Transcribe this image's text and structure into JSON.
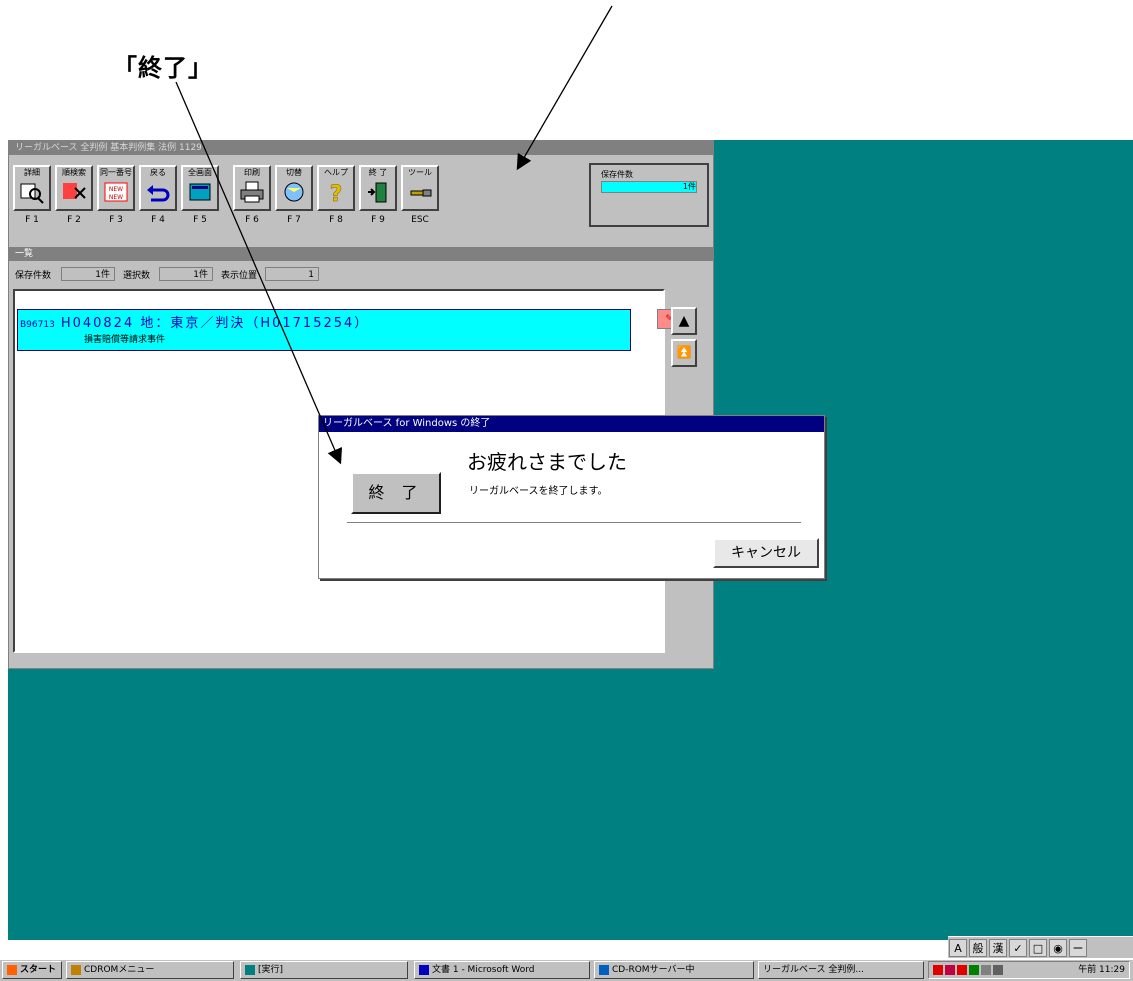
{
  "annotation": {
    "label": "「終了」"
  },
  "app": {
    "title": "リーガルベース 全判例 基本判例集 法例 1129",
    "toolbar": {
      "buttons": [
        {
          "label": "詳細",
          "fkey": "F 1",
          "icon": "magnifier-icon"
        },
        {
          "label": "順検索",
          "fkey": "F 2",
          "icon": "search-scissors-icon"
        },
        {
          "label": "同一番号",
          "fkey": "F 3",
          "icon": "new-badge-icon"
        },
        {
          "label": "戻る",
          "fkey": "F 4",
          "icon": "return-arrow-icon"
        },
        {
          "label": "全画面",
          "fkey": "F 5",
          "icon": "fullscreen-icon"
        },
        {
          "label": "印刷",
          "fkey": "F 6",
          "icon": "printer-icon"
        },
        {
          "label": "切替",
          "fkey": "F 7",
          "icon": "globe-switch-icon"
        },
        {
          "label": "ヘルプ",
          "fkey": "F 8",
          "icon": "help-question-icon"
        },
        {
          "label": "終 了",
          "fkey": "F 9",
          "icon": "exit-door-icon"
        },
        {
          "label": "ツール",
          "fkey": "ESC",
          "icon": "tool-icon"
        }
      ],
      "count_box": {
        "label": "保存件数",
        "value": "1件"
      }
    },
    "subbar_title": "一覧",
    "status": {
      "saved_label": "保存件数",
      "saved_value": "1件",
      "selected_label": "選択数",
      "selected_value": "1件",
      "position_label": "表示位置",
      "position_value": "1"
    },
    "results": [
      {
        "id": "B96713",
        "line1": "H040824 地：東京／判決（H01715254）",
        "line2": "損害賠償等請求事件"
      }
    ]
  },
  "dialog": {
    "title": "リーガルベース for Windows の終了",
    "heading": "お疲れさまでした",
    "message": "リーガルベースを終了します。",
    "exit_label": "終 了",
    "cancel_label": "キャンセル"
  },
  "ime": [
    "A",
    "般",
    "漢",
    "✓",
    "□",
    "◉",
    "ー"
  ],
  "taskbar": {
    "start": "スタート",
    "tasks": [
      "CDROMメニュー",
      "[実行]",
      "文書 1 - Microsoft Word",
      "CD-ROMサーバー中",
      "リーガルベース 全判例..."
    ],
    "clock": "午前 11:29"
  },
  "colors": {
    "desktop": "#008080",
    "highlight": "#00ffff",
    "title_active": "#000080"
  }
}
